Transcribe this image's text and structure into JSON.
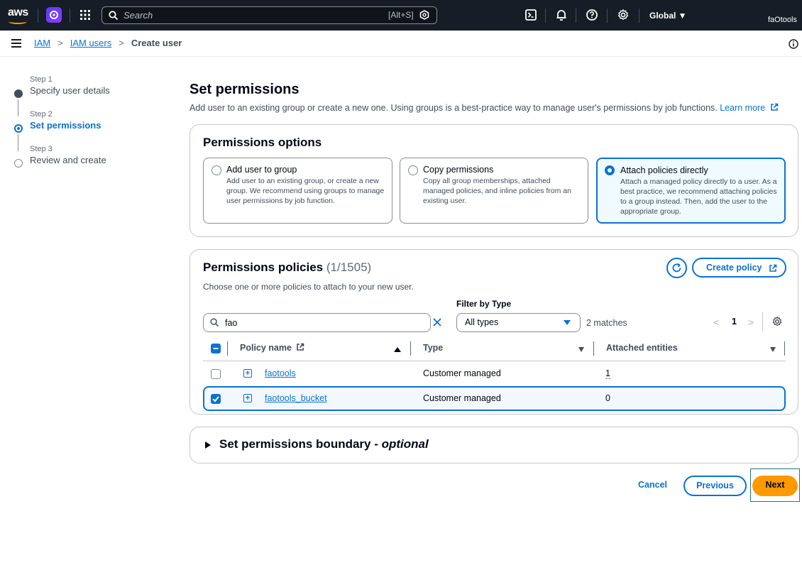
{
  "topnav": {
    "logo": "aws",
    "search_placeholder": "Search",
    "search_shortcut": "[Alt+S]",
    "region": "Global ▼",
    "account": "faOtools"
  },
  "breadcrumbs": {
    "items": [
      "IAM",
      "IAM users"
    ],
    "current": "Create user"
  },
  "steps": [
    {
      "num": "Step 1",
      "title": "Specify user details",
      "state": "done"
    },
    {
      "num": "Step 2",
      "title": "Set permissions",
      "state": "current"
    },
    {
      "num": "Step 3",
      "title": "Review and create",
      "state": "pending"
    }
  ],
  "page": {
    "title": "Set permissions",
    "description": "Add user to an existing group or create a new one. Using groups is a best-practice way to manage user's permissions by job functions.",
    "learn_more": "Learn more"
  },
  "options": {
    "title": "Permissions options",
    "tiles": [
      {
        "title": "Add user to group",
        "desc": "Add user to an existing group, or create a new group. We recommend using groups to manage user permissions by job function.",
        "selected": false
      },
      {
        "title": "Copy permissions",
        "desc": "Copy all group memberships, attached managed policies, and inline policies from an existing user.",
        "selected": false
      },
      {
        "title": "Attach policies directly",
        "desc": "Attach a managed policy directly to a user. As a best practice, we recommend attaching policies to a group instead. Then, add the user to the appropriate group.",
        "selected": true
      }
    ]
  },
  "policies": {
    "title": "Permissions policies",
    "count": "(1/1505)",
    "description": "Choose one or more policies to attach to your new user.",
    "create_label": "Create policy",
    "filter_label": "Filter by Type",
    "search_value": "fao",
    "type_value": "All types",
    "matches": "2 matches",
    "page": "1",
    "columns": [
      "Policy name",
      "Type",
      "Attached entities"
    ],
    "rows": [
      {
        "name": "faotools",
        "type": "Customer managed",
        "attached": "1",
        "checked": false
      },
      {
        "name": "faotools_bucket",
        "type": "Customer managed",
        "attached": "0",
        "checked": true
      }
    ]
  },
  "boundary": {
    "title": "Set permissions boundary - ",
    "optional": "optional"
  },
  "actions": {
    "cancel": "Cancel",
    "previous": "Previous",
    "next": "Next"
  },
  "colors": {
    "primary": "#0972d3",
    "nav_bg": "#161d26",
    "next_bg": "#ff9900"
  }
}
